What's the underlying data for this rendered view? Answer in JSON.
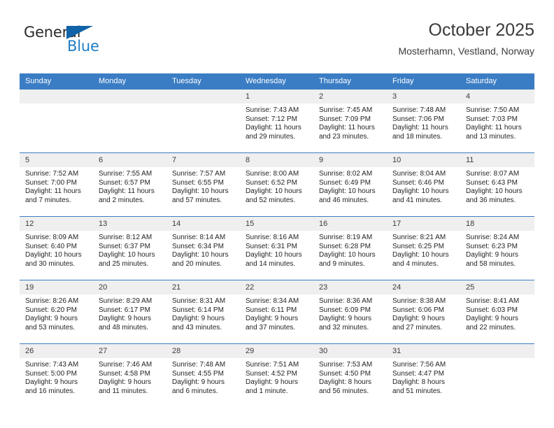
{
  "brand": {
    "name_part1": "General",
    "name_part2": "Blue",
    "accent_color": "#1f7dc4",
    "triangle_color": "#1163a8"
  },
  "header": {
    "month_title": "October 2025",
    "location": "Mosterhamn, Vestland, Norway",
    "header_bg": "#3b7dc4"
  },
  "weekday_headers": [
    "Sunday",
    "Monday",
    "Tuesday",
    "Wednesday",
    "Thursday",
    "Friday",
    "Saturday"
  ],
  "weeks": [
    [
      {
        "day": "",
        "empty": true,
        "sunrise": "",
        "sunset": "",
        "daylight_line1": "",
        "daylight_line2": ""
      },
      {
        "day": "",
        "empty": true,
        "sunrise": "",
        "sunset": "",
        "daylight_line1": "",
        "daylight_line2": ""
      },
      {
        "day": "",
        "empty": true,
        "sunrise": "",
        "sunset": "",
        "daylight_line1": "",
        "daylight_line2": ""
      },
      {
        "day": "1",
        "empty": false,
        "sunrise": "Sunrise: 7:43 AM",
        "sunset": "Sunset: 7:12 PM",
        "daylight_line1": "Daylight: 11 hours",
        "daylight_line2": "and 29 minutes."
      },
      {
        "day": "2",
        "empty": false,
        "sunrise": "Sunrise: 7:45 AM",
        "sunset": "Sunset: 7:09 PM",
        "daylight_line1": "Daylight: 11 hours",
        "daylight_line2": "and 23 minutes."
      },
      {
        "day": "3",
        "empty": false,
        "sunrise": "Sunrise: 7:48 AM",
        "sunset": "Sunset: 7:06 PM",
        "daylight_line1": "Daylight: 11 hours",
        "daylight_line2": "and 18 minutes."
      },
      {
        "day": "4",
        "empty": false,
        "sunrise": "Sunrise: 7:50 AM",
        "sunset": "Sunset: 7:03 PM",
        "daylight_line1": "Daylight: 11 hours",
        "daylight_line2": "and 13 minutes."
      }
    ],
    [
      {
        "day": "5",
        "empty": false,
        "sunrise": "Sunrise: 7:52 AM",
        "sunset": "Sunset: 7:00 PM",
        "daylight_line1": "Daylight: 11 hours",
        "daylight_line2": "and 7 minutes."
      },
      {
        "day": "6",
        "empty": false,
        "sunrise": "Sunrise: 7:55 AM",
        "sunset": "Sunset: 6:57 PM",
        "daylight_line1": "Daylight: 11 hours",
        "daylight_line2": "and 2 minutes."
      },
      {
        "day": "7",
        "empty": false,
        "sunrise": "Sunrise: 7:57 AM",
        "sunset": "Sunset: 6:55 PM",
        "daylight_line1": "Daylight: 10 hours",
        "daylight_line2": "and 57 minutes."
      },
      {
        "day": "8",
        "empty": false,
        "sunrise": "Sunrise: 8:00 AM",
        "sunset": "Sunset: 6:52 PM",
        "daylight_line1": "Daylight: 10 hours",
        "daylight_line2": "and 52 minutes."
      },
      {
        "day": "9",
        "empty": false,
        "sunrise": "Sunrise: 8:02 AM",
        "sunset": "Sunset: 6:49 PM",
        "daylight_line1": "Daylight: 10 hours",
        "daylight_line2": "and 46 minutes."
      },
      {
        "day": "10",
        "empty": false,
        "sunrise": "Sunrise: 8:04 AM",
        "sunset": "Sunset: 6:46 PM",
        "daylight_line1": "Daylight: 10 hours",
        "daylight_line2": "and 41 minutes."
      },
      {
        "day": "11",
        "empty": false,
        "sunrise": "Sunrise: 8:07 AM",
        "sunset": "Sunset: 6:43 PM",
        "daylight_line1": "Daylight: 10 hours",
        "daylight_line2": "and 36 minutes."
      }
    ],
    [
      {
        "day": "12",
        "empty": false,
        "sunrise": "Sunrise: 8:09 AM",
        "sunset": "Sunset: 6:40 PM",
        "daylight_line1": "Daylight: 10 hours",
        "daylight_line2": "and 30 minutes."
      },
      {
        "day": "13",
        "empty": false,
        "sunrise": "Sunrise: 8:12 AM",
        "sunset": "Sunset: 6:37 PM",
        "daylight_line1": "Daylight: 10 hours",
        "daylight_line2": "and 25 minutes."
      },
      {
        "day": "14",
        "empty": false,
        "sunrise": "Sunrise: 8:14 AM",
        "sunset": "Sunset: 6:34 PM",
        "daylight_line1": "Daylight: 10 hours",
        "daylight_line2": "and 20 minutes."
      },
      {
        "day": "15",
        "empty": false,
        "sunrise": "Sunrise: 8:16 AM",
        "sunset": "Sunset: 6:31 PM",
        "daylight_line1": "Daylight: 10 hours",
        "daylight_line2": "and 14 minutes."
      },
      {
        "day": "16",
        "empty": false,
        "sunrise": "Sunrise: 8:19 AM",
        "sunset": "Sunset: 6:28 PM",
        "daylight_line1": "Daylight: 10 hours",
        "daylight_line2": "and 9 minutes."
      },
      {
        "day": "17",
        "empty": false,
        "sunrise": "Sunrise: 8:21 AM",
        "sunset": "Sunset: 6:25 PM",
        "daylight_line1": "Daylight: 10 hours",
        "daylight_line2": "and 4 minutes."
      },
      {
        "day": "18",
        "empty": false,
        "sunrise": "Sunrise: 8:24 AM",
        "sunset": "Sunset: 6:23 PM",
        "daylight_line1": "Daylight: 9 hours",
        "daylight_line2": "and 58 minutes."
      }
    ],
    [
      {
        "day": "19",
        "empty": false,
        "sunrise": "Sunrise: 8:26 AM",
        "sunset": "Sunset: 6:20 PM",
        "daylight_line1": "Daylight: 9 hours",
        "daylight_line2": "and 53 minutes."
      },
      {
        "day": "20",
        "empty": false,
        "sunrise": "Sunrise: 8:29 AM",
        "sunset": "Sunset: 6:17 PM",
        "daylight_line1": "Daylight: 9 hours",
        "daylight_line2": "and 48 minutes."
      },
      {
        "day": "21",
        "empty": false,
        "sunrise": "Sunrise: 8:31 AM",
        "sunset": "Sunset: 6:14 PM",
        "daylight_line1": "Daylight: 9 hours",
        "daylight_line2": "and 43 minutes."
      },
      {
        "day": "22",
        "empty": false,
        "sunrise": "Sunrise: 8:34 AM",
        "sunset": "Sunset: 6:11 PM",
        "daylight_line1": "Daylight: 9 hours",
        "daylight_line2": "and 37 minutes."
      },
      {
        "day": "23",
        "empty": false,
        "sunrise": "Sunrise: 8:36 AM",
        "sunset": "Sunset: 6:09 PM",
        "daylight_line1": "Daylight: 9 hours",
        "daylight_line2": "and 32 minutes."
      },
      {
        "day": "24",
        "empty": false,
        "sunrise": "Sunrise: 8:38 AM",
        "sunset": "Sunset: 6:06 PM",
        "daylight_line1": "Daylight: 9 hours",
        "daylight_line2": "and 27 minutes."
      },
      {
        "day": "25",
        "empty": false,
        "sunrise": "Sunrise: 8:41 AM",
        "sunset": "Sunset: 6:03 PM",
        "daylight_line1": "Daylight: 9 hours",
        "daylight_line2": "and 22 minutes."
      }
    ],
    [
      {
        "day": "26",
        "empty": false,
        "sunrise": "Sunrise: 7:43 AM",
        "sunset": "Sunset: 5:00 PM",
        "daylight_line1": "Daylight: 9 hours",
        "daylight_line2": "and 16 minutes."
      },
      {
        "day": "27",
        "empty": false,
        "sunrise": "Sunrise: 7:46 AM",
        "sunset": "Sunset: 4:58 PM",
        "daylight_line1": "Daylight: 9 hours",
        "daylight_line2": "and 11 minutes."
      },
      {
        "day": "28",
        "empty": false,
        "sunrise": "Sunrise: 7:48 AM",
        "sunset": "Sunset: 4:55 PM",
        "daylight_line1": "Daylight: 9 hours",
        "daylight_line2": "and 6 minutes."
      },
      {
        "day": "29",
        "empty": false,
        "sunrise": "Sunrise: 7:51 AM",
        "sunset": "Sunset: 4:52 PM",
        "daylight_line1": "Daylight: 9 hours",
        "daylight_line2": "and 1 minute."
      },
      {
        "day": "30",
        "empty": false,
        "sunrise": "Sunrise: 7:53 AM",
        "sunset": "Sunset: 4:50 PM",
        "daylight_line1": "Daylight: 8 hours",
        "daylight_line2": "and 56 minutes."
      },
      {
        "day": "31",
        "empty": false,
        "sunrise": "Sunrise: 7:56 AM",
        "sunset": "Sunset: 4:47 PM",
        "daylight_line1": "Daylight: 8 hours",
        "daylight_line2": "and 51 minutes."
      },
      {
        "day": "",
        "empty": true,
        "sunrise": "",
        "sunset": "",
        "daylight_line1": "",
        "daylight_line2": ""
      }
    ]
  ]
}
